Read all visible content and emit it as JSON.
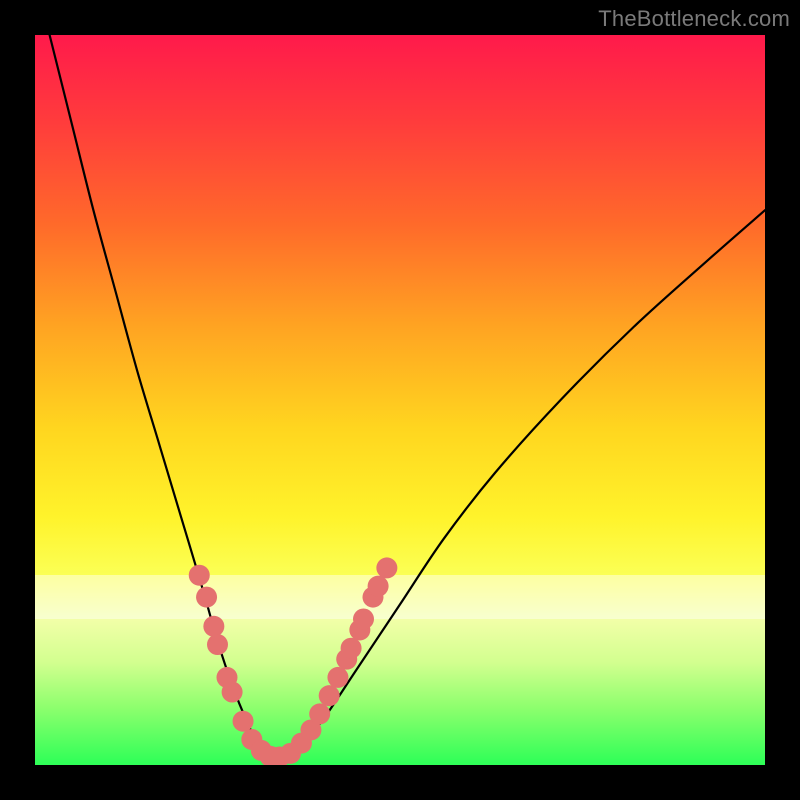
{
  "watermark": "TheBottleneck.com",
  "chart_data": {
    "type": "line",
    "title": "",
    "xlabel": "",
    "ylabel": "",
    "xlim": [
      0,
      100
    ],
    "ylim": [
      0,
      100
    ],
    "grid": false,
    "legend": false,
    "series": [
      {
        "name": "bottleneck-curve",
        "x": [
          2,
          5,
          8,
          11,
          14,
          17,
          20,
          23,
          25,
          27,
          29,
          30.5,
          32,
          33.5,
          35,
          37,
          40,
          44,
          50,
          56,
          63,
          72,
          82,
          92,
          100
        ],
        "y": [
          100,
          88,
          76,
          65,
          54,
          44,
          34,
          24,
          17,
          11,
          6,
          3,
          1.2,
          1,
          1.5,
          3.2,
          7,
          13,
          22,
          31,
          40,
          50,
          60,
          69,
          76
        ]
      }
    ],
    "marker_points": {
      "name": "highlighted-dots",
      "color": "#e4716f",
      "points": [
        {
          "x": 22.5,
          "y": 26
        },
        {
          "x": 23.5,
          "y": 23
        },
        {
          "x": 24.5,
          "y": 19
        },
        {
          "x": 25.0,
          "y": 16.5
        },
        {
          "x": 26.3,
          "y": 12
        },
        {
          "x": 27.0,
          "y": 10
        },
        {
          "x": 28.5,
          "y": 6
        },
        {
          "x": 29.7,
          "y": 3.5
        },
        {
          "x": 31.0,
          "y": 2
        },
        {
          "x": 32.2,
          "y": 1.2
        },
        {
          "x": 33.5,
          "y": 1.1
        },
        {
          "x": 35.0,
          "y": 1.6
        },
        {
          "x": 36.5,
          "y": 3
        },
        {
          "x": 37.8,
          "y": 4.8
        },
        {
          "x": 39.0,
          "y": 7
        },
        {
          "x": 40.3,
          "y": 9.5
        },
        {
          "x": 41.5,
          "y": 12
        },
        {
          "x": 42.7,
          "y": 14.5
        },
        {
          "x": 43.3,
          "y": 16
        },
        {
          "x": 44.5,
          "y": 18.5
        },
        {
          "x": 45.0,
          "y": 20
        },
        {
          "x": 46.3,
          "y": 23
        },
        {
          "x": 47.0,
          "y": 24.5
        },
        {
          "x": 48.2,
          "y": 27
        }
      ]
    },
    "background_gradient": {
      "orientation": "vertical",
      "stops": [
        {
          "pos": 0.0,
          "color": "#ff1a4b"
        },
        {
          "pos": 0.4,
          "color": "#ffa422"
        },
        {
          "pos": 0.66,
          "color": "#fff32b"
        },
        {
          "pos": 0.8,
          "color": "#f2ffa8"
        },
        {
          "pos": 1.0,
          "color": "#2dff57"
        }
      ]
    },
    "pale_band": {
      "y_from": 20,
      "y_to": 26
    }
  }
}
